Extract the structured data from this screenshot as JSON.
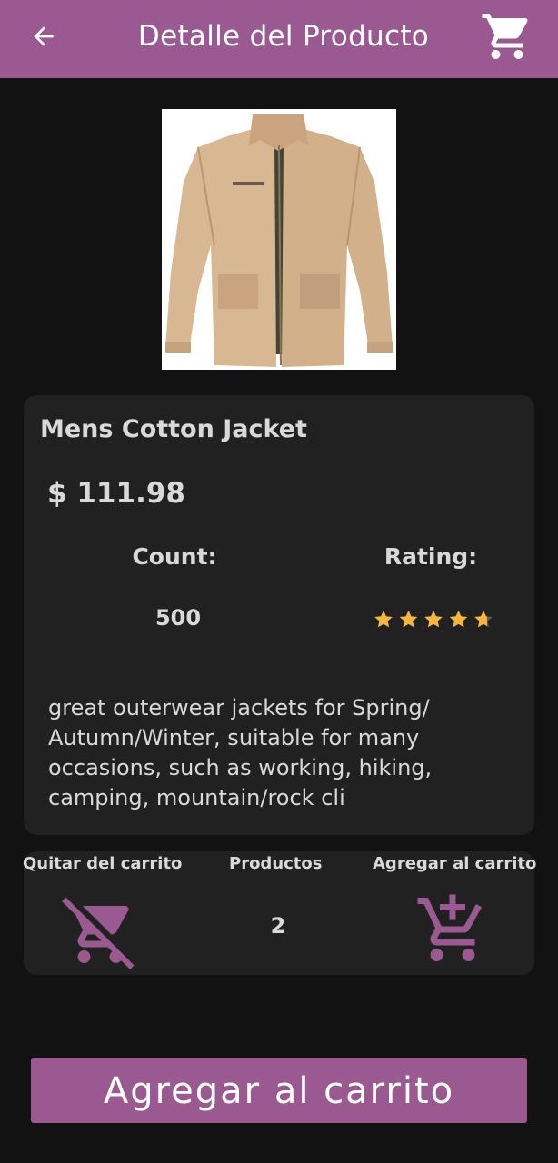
{
  "appbar": {
    "title": "Detalle del Producto",
    "back_icon": "arrow-back-icon",
    "cart_icon": "shopping-cart-icon",
    "background_color": "#9a5a91"
  },
  "product": {
    "title": "Mens Cotton Jacket",
    "price": "$ 111.98",
    "count_label": "Count:",
    "count_value": "500",
    "rating_label": "Rating:",
    "rating_value": 4.7,
    "rating_max": 5,
    "description": "great outerwear jackets for Spring/ Autumn/Winter, suitable for many occasions, such as working, hiking, camping, mountain/rock cli"
  },
  "quantity": {
    "remove_label": "Quitar del carrito",
    "products_label": "Productos",
    "add_label": "Agregar al carrito",
    "value": "2",
    "remove_icon": "remove-shopping-cart-icon",
    "add_icon": "add-shopping-cart-icon"
  },
  "cta": {
    "label": "Agregar al carrito"
  },
  "colors": {
    "accent": "#9a5a91",
    "background": "#121212",
    "card": "#212121",
    "star": "#f4b63f"
  }
}
